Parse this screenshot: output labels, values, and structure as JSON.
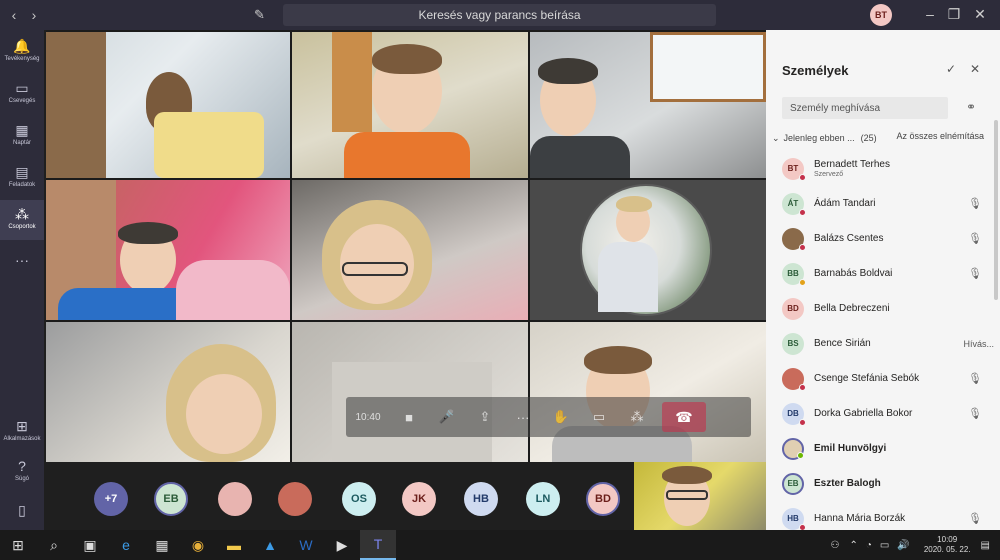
{
  "window": {
    "search_placeholder": "Keresés vagy parancs beírása",
    "user_initials": "BT"
  },
  "rail": [
    {
      "label": "Tevékenység",
      "icon": "bell-icon"
    },
    {
      "label": "Csevegés",
      "icon": "chat-icon"
    },
    {
      "label": "Naptár",
      "icon": "calendar-icon"
    },
    {
      "label": "Feladatok",
      "icon": "assignments-icon"
    },
    {
      "label": "Csoportok",
      "icon": "teams-icon"
    },
    {
      "label": "Alkalmazások",
      "icon": "apps-icon"
    },
    {
      "label": "Súgó",
      "icon": "help-icon"
    }
  ],
  "call": {
    "time": "10:40"
  },
  "strip": {
    "more_count": "+7",
    "avatars": [
      "EB",
      "",
      "",
      "OS",
      "JK",
      "HB",
      "LN",
      "BD"
    ]
  },
  "panel": {
    "title": "Személyek",
    "invite_placeholder": "Személy meghívása",
    "section_label": "Jelenleg ebben ...",
    "section_count": "(25)",
    "mute_all": "Az összes elnémítása",
    "people": [
      {
        "initials": "BT",
        "name": "Bernadett Terhes",
        "sub": "Szervező",
        "bold": false,
        "mic": false,
        "status": ""
      },
      {
        "initials": "ÁT",
        "name": "Ádám Tandari",
        "sub": "",
        "bold": false,
        "mic": true,
        "status": ""
      },
      {
        "initials": "",
        "name": "Balázs Csentes",
        "sub": "",
        "bold": false,
        "mic": true,
        "status": ""
      },
      {
        "initials": "BB",
        "name": "Barnabás Boldvai",
        "sub": "",
        "bold": false,
        "mic": true,
        "status": ""
      },
      {
        "initials": "BD",
        "name": "Bella Debreczeni",
        "sub": "",
        "bold": false,
        "mic": false,
        "status": ""
      },
      {
        "initials": "BS",
        "name": "Bence Sirián",
        "sub": "",
        "bold": false,
        "mic": false,
        "status": "Hívás..."
      },
      {
        "initials": "",
        "name": "Csenge Stefánia Sebók",
        "sub": "",
        "bold": false,
        "mic": true,
        "status": ""
      },
      {
        "initials": "DB",
        "name": "Dorka Gabriella Bokor",
        "sub": "",
        "bold": false,
        "mic": true,
        "status": ""
      },
      {
        "initials": "",
        "name": "Emil Hunvölgyi",
        "sub": "",
        "bold": true,
        "mic": false,
        "status": ""
      },
      {
        "initials": "EB",
        "name": "Eszter Balogh",
        "sub": "",
        "bold": true,
        "mic": false,
        "status": ""
      },
      {
        "initials": "HB",
        "name": "Hanna Mária Borzák",
        "sub": "",
        "bold": false,
        "mic": true,
        "status": ""
      }
    ]
  },
  "taskbar": {
    "time": "10:09",
    "date": "2020. 05. 22."
  }
}
